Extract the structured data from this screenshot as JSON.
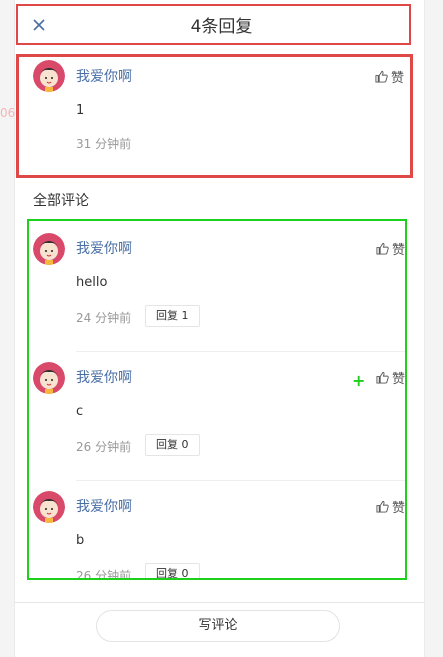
{
  "header": {
    "title": "4条回复",
    "close_icon": "close-icon"
  },
  "side_mark": "06",
  "main_comment": {
    "author": "我爱你啊",
    "content": "1",
    "time": "31 分钟前",
    "like_label": "赞"
  },
  "section": {
    "title": "全部评论"
  },
  "comments": [
    {
      "author": "我爱你啊",
      "content": "hello",
      "time": "24 分钟前",
      "reply_label": "回复 1",
      "like_label": "赞"
    },
    {
      "author": "我爱你啊",
      "content": "c",
      "time": "26 分钟前",
      "reply_label": "回复 0",
      "like_label": "赞"
    },
    {
      "author": "我爱你啊",
      "content": "b",
      "time": "26 分钟前",
      "reply_label": "回复 0",
      "like_label": "赞"
    }
  ],
  "footer": {
    "write_label": "写评论"
  },
  "colors": {
    "accent_red": "#e04848",
    "accent_green": "#1ed01e",
    "author": "#4a6fa5",
    "close": "#4a6fa5"
  }
}
